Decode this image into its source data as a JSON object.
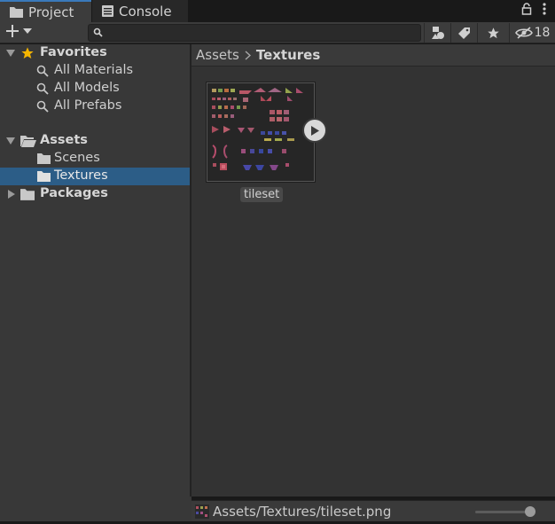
{
  "tabs": [
    {
      "label": "Project",
      "icon": "folder-icon",
      "active": true
    },
    {
      "label": "Console",
      "icon": "console-icon",
      "active": false
    }
  ],
  "toolbar": {
    "search_value": "",
    "hidden_count": "18"
  },
  "tree": {
    "favorites": {
      "label": "Favorites",
      "items": [
        "All Materials",
        "All Models",
        "All Prefabs"
      ]
    },
    "assets": {
      "label": "Assets",
      "children": [
        "Scenes",
        "Textures"
      ],
      "selected": "Textures"
    },
    "packages": {
      "label": "Packages"
    }
  },
  "breadcrumb": {
    "items": [
      "Assets",
      "Textures"
    ]
  },
  "asset": {
    "name": "tileset"
  },
  "status": {
    "path": "Assets/Textures/tileset.png",
    "zoom_fraction": 0.95
  },
  "colors": {
    "selection": "#2c5d87",
    "accent_tab": "#3a79bb",
    "star": "#f5b500"
  }
}
